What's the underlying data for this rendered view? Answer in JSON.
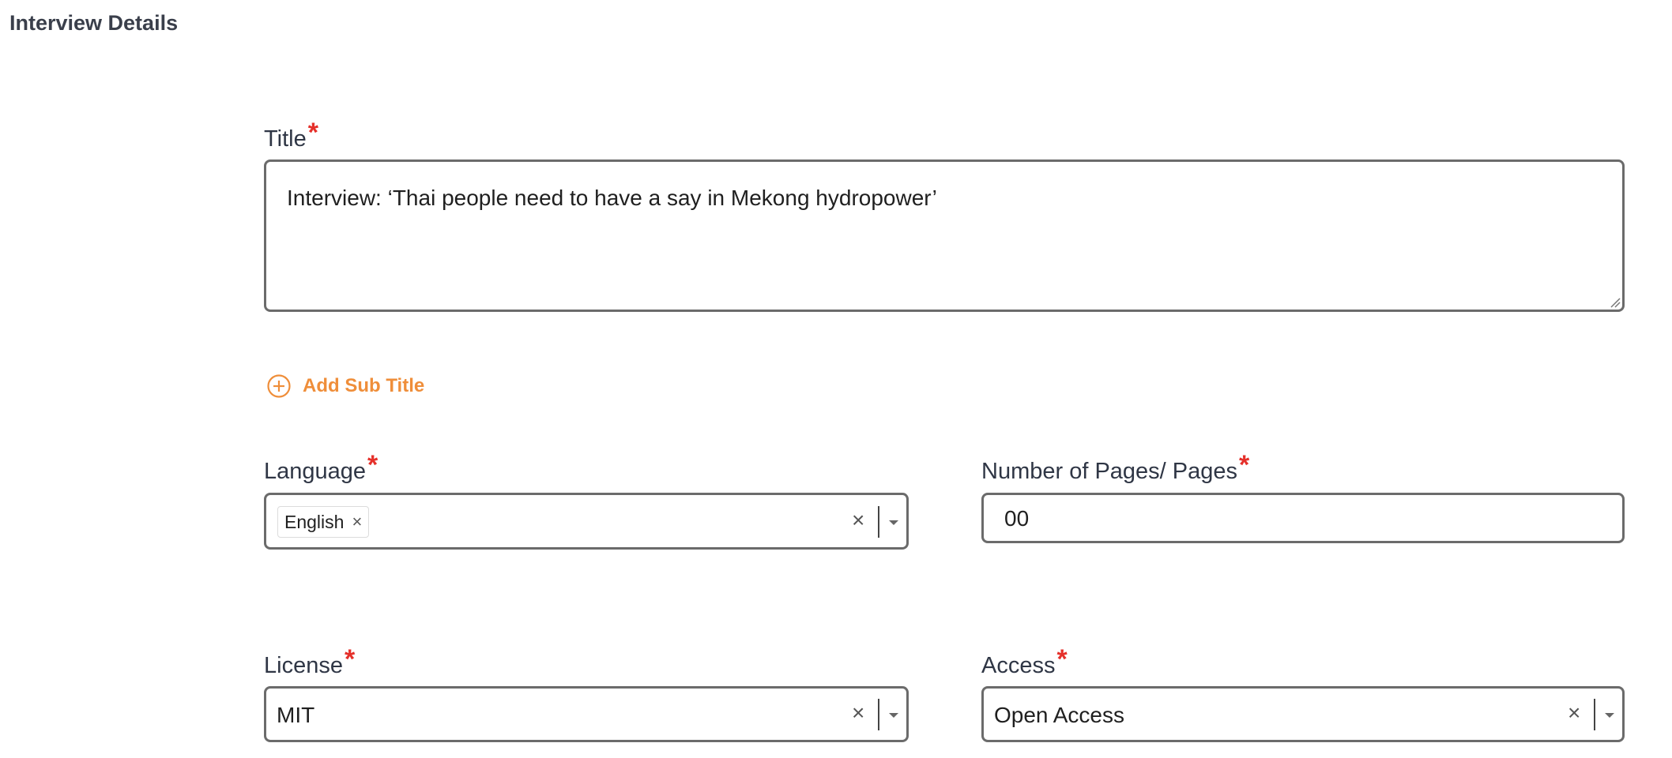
{
  "section": {
    "title": "Interview Details"
  },
  "form": {
    "required_mark": "*",
    "title": {
      "label": "Title",
      "value": "Interview: ‘Thai people need to have a say in Mekong hydropower’"
    },
    "add_subtitle": {
      "label": "Add Sub Title",
      "icon": "plus-circle-icon"
    },
    "language": {
      "label": "Language",
      "tags": [
        {
          "label": "English",
          "remove": "×"
        }
      ],
      "clear": "×"
    },
    "pages": {
      "label": "Number of Pages/ Pages",
      "value": "00"
    },
    "license": {
      "label": "License",
      "value": "MIT",
      "clear": "×"
    },
    "access": {
      "label": "Access",
      "value": "Open Access",
      "clear": "×"
    }
  },
  "colors": {
    "accent": "#ef8e3a",
    "required": "#e5302a",
    "border": "#6b6b6b",
    "label": "#2f3645"
  }
}
